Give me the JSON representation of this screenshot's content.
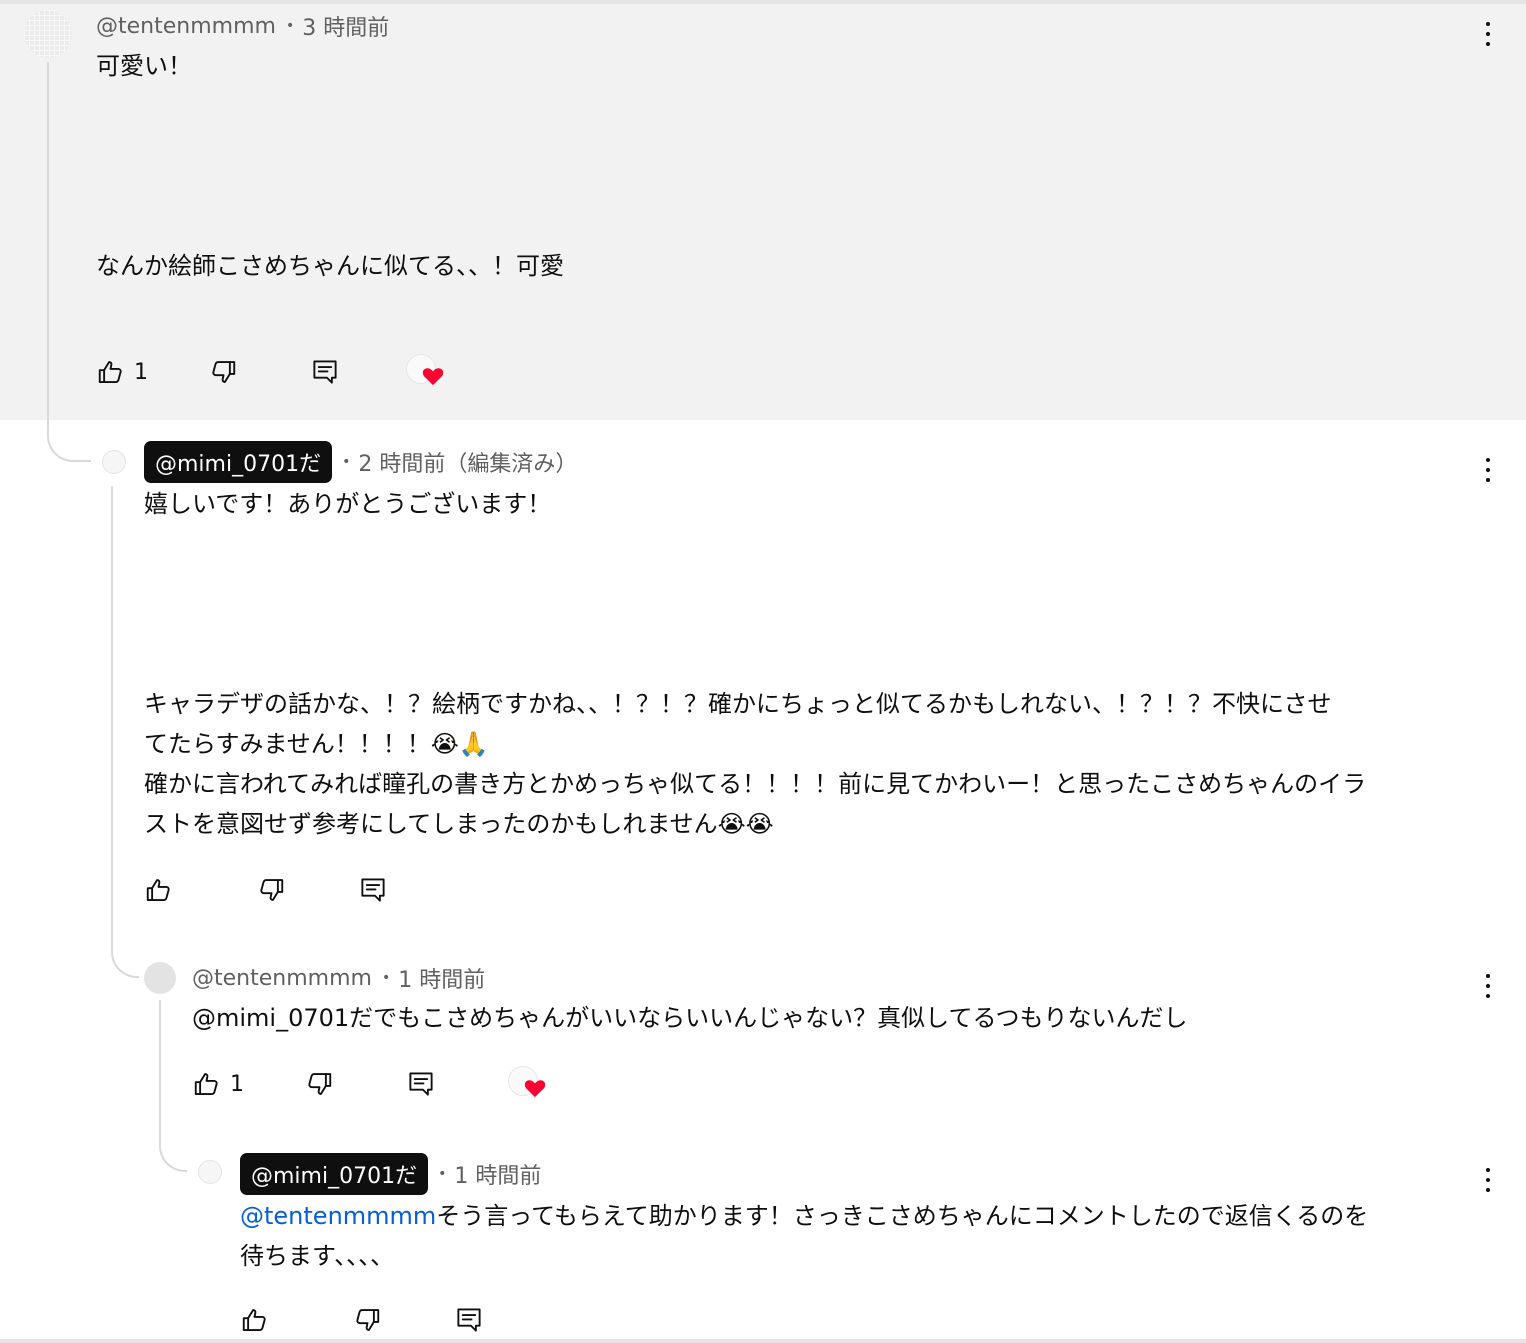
{
  "comments": {
    "c1": {
      "handle": "@tentenmmmm",
      "separator": "•",
      "time": "3 時間前",
      "line1": "可愛い！",
      "line2": "なんか絵師こさめちゃんに似てる、、！可愛",
      "likes": "1"
    },
    "c2": {
      "handle": "@mimi_0701だ",
      "separator": "•",
      "time": "2 時間前（編集済み）",
      "line1": "嬉しいです！ありがとうございます！",
      "line2": "キャラデザの話かな、！？絵柄ですかね、、！？！？確かにちょっと似てるかもしれない、！？！？不快にさせ",
      "line3": "てたらすみません！！！！😭🙏",
      "line4": "確かに言われてみれば瞳孔の書き方とかめっちゃ似てる！！！！前に見てかわいー！と思ったこさめちゃんのイラ",
      "line5": "ストを意図せず参考にしてしまったのかもしれません😭😭"
    },
    "c3": {
      "handle": "@tentenmmmm",
      "separator": "•",
      "time": "1 時間前",
      "text": "@mimi_0701だでもこさめちゃんがいいならいいんじゃない？真似してるつもりないんだし",
      "likes": "1"
    },
    "c4": {
      "handle": "@mimi_0701だ",
      "separator": "•",
      "time": "1 時間前",
      "mention": "@tentenmmmm",
      "line1": "そう言ってもらえて助かります！さっきこさめちゃんにコメントしたので返信くるのを",
      "line2": "待ちます、、、、"
    }
  },
  "icons": {
    "like": "thumbs-up-icon",
    "dislike": "thumbs-down-icon",
    "reply": "reply-icon",
    "more": "more-vert-icon",
    "creator_heart": "creator-heart-icon"
  },
  "colors": {
    "highlight_bg": "#f2f2f2",
    "owner_badge_bg": "#0f0f0f",
    "mention": "#065fd4",
    "heart": "#ff0033"
  }
}
